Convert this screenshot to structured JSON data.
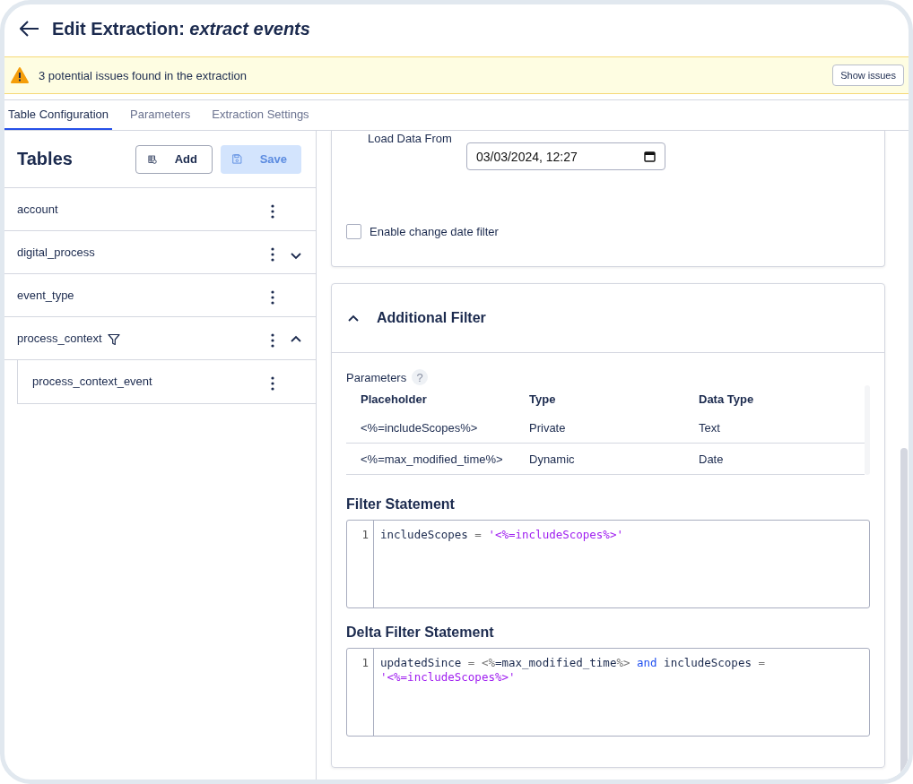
{
  "header": {
    "title_prefix": "Edit Extraction:",
    "title_name": "extract events"
  },
  "banner": {
    "message": "3 potential issues found in the extraction",
    "button": "Show issues"
  },
  "tabs": [
    {
      "label": "Table Configuration",
      "selected": true
    },
    {
      "label": "Parameters",
      "selected": false
    },
    {
      "label": "Extraction Settings",
      "selected": false
    }
  ],
  "sidebar": {
    "title": "Tables",
    "add_button": "Add",
    "save_button": {
      "label": "Save",
      "disabled": true
    },
    "items": [
      {
        "name": "account"
      },
      {
        "name": "digital_process",
        "expanded": false
      },
      {
        "name": "event_type"
      },
      {
        "name": "process_context",
        "filter": true,
        "expanded": true,
        "children": [
          {
            "name": "process_context_event"
          }
        ]
      }
    ]
  },
  "load_settings": {
    "label": "Load Data From",
    "value": "03/03/2024, 12:27",
    "checkbox": {
      "label": "Enable change date filter",
      "checked": false
    }
  },
  "additional_filter": {
    "title": "Additional Filter",
    "expanded": true,
    "parameters_label": "Parameters",
    "help": "?",
    "table": {
      "columns": [
        "Placeholder",
        "Type",
        "Data Type"
      ],
      "rows": [
        [
          "<%=includeScopes%>",
          "Private",
          "Text"
        ],
        [
          "<%=max_modified_time%>",
          "Dynamic",
          "Date"
        ]
      ]
    },
    "filter_statement": {
      "title": "Filter Statement",
      "lines": [
        {
          "number": "1",
          "tokens": [
            {
              "kind": "plain",
              "text": "includeScopes "
            },
            {
              "kind": "op",
              "text": "= "
            },
            {
              "kind": "string",
              "text": "'<%=includeScopes%>'"
            }
          ]
        }
      ]
    },
    "delta_filter_statement": {
      "title": "Delta Filter Statement",
      "lines": [
        {
          "number": "1",
          "tokens": [
            {
              "kind": "plain",
              "text": "updatedSince "
            },
            {
              "kind": "op",
              "text": "= <%"
            },
            {
              "kind": "plain",
              "text": "=max_modified_time"
            },
            {
              "kind": "op",
              "text": "%> "
            },
            {
              "kind": "keyword",
              "text": "and"
            },
            {
              "kind": "plain",
              "text": " includeScopes "
            },
            {
              "kind": "op",
              "text": "= "
            },
            {
              "kind": "string",
              "text": "'<%=includeScopes%>'"
            }
          ]
        }
      ]
    }
  }
}
